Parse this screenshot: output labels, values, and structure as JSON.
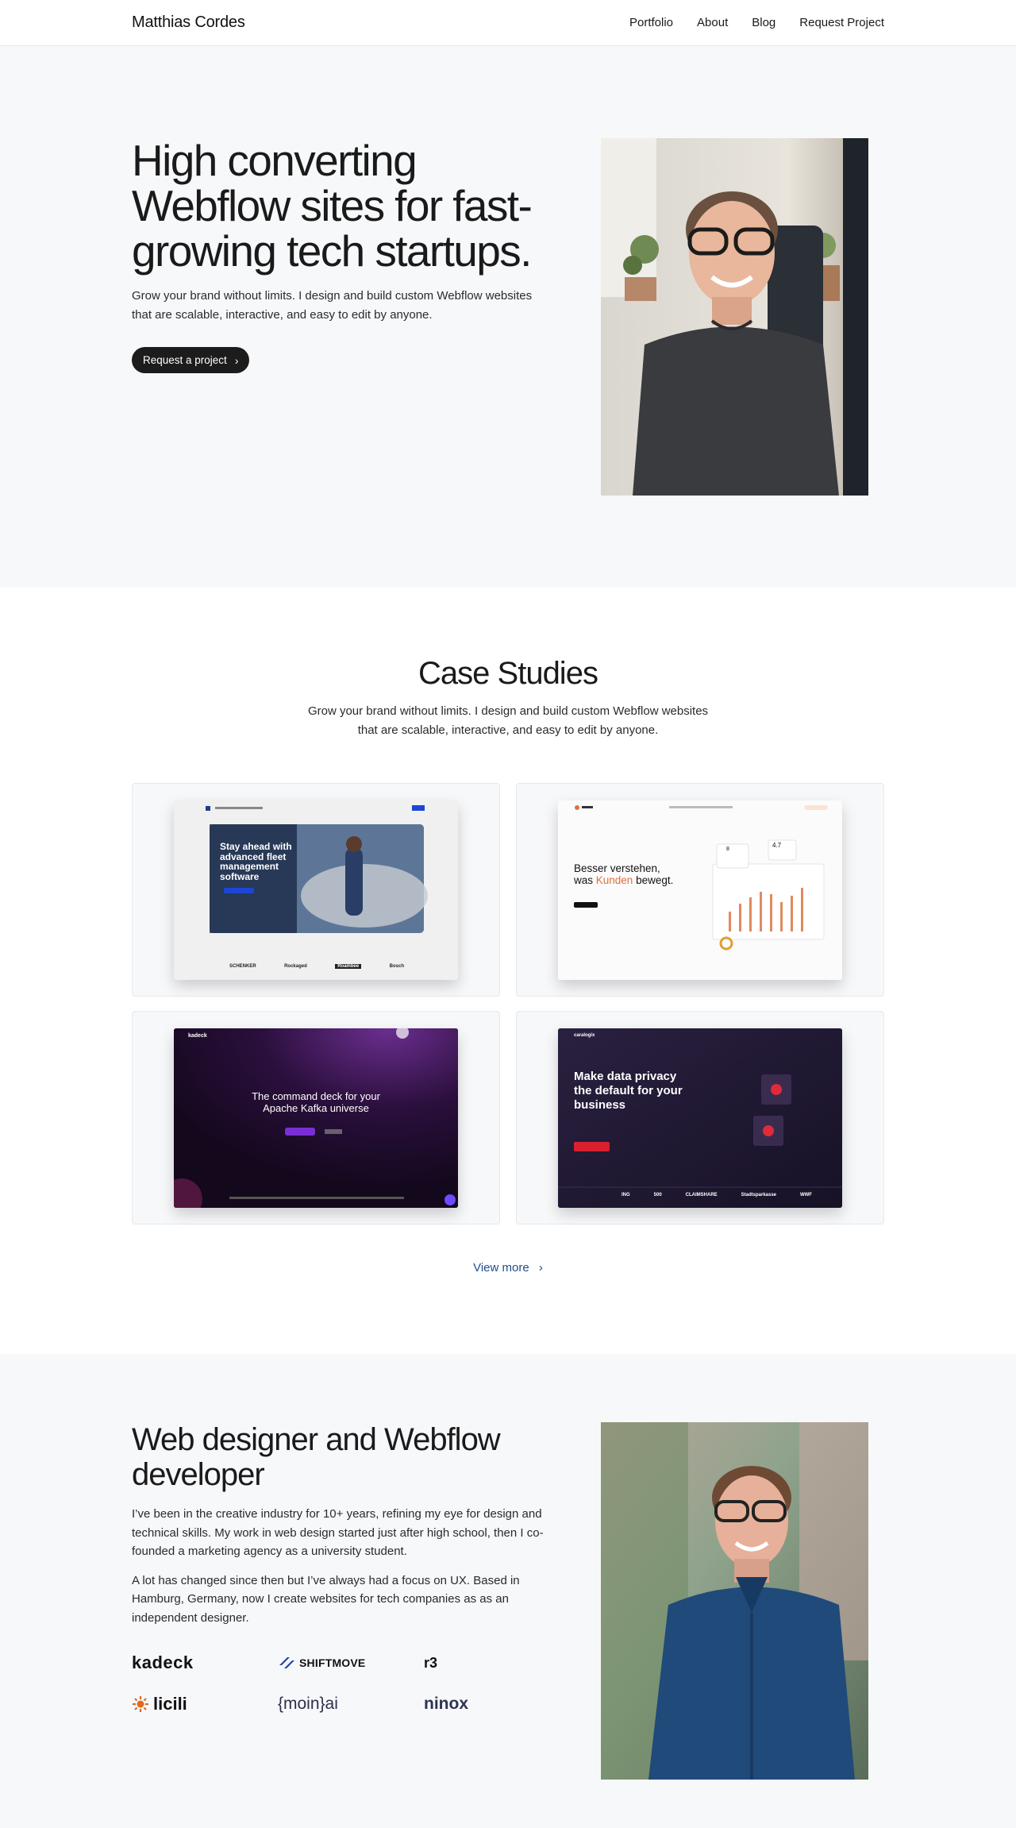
{
  "nav": {
    "brand": "Matthias Cordes",
    "links": [
      "Portfolio",
      "About",
      "Blog",
      "Request Project"
    ]
  },
  "hero": {
    "headline": "High converting Webflow sites for fast-growing tech startups.",
    "description": "Grow your brand without limits. I design and build custom Webflow websites that are scalable, interactive, and easy to edit by anyone.",
    "cta_label": "Request a project"
  },
  "case_studies": {
    "title": "Case Studies",
    "description": "Grow your brand without limits. I design and build custom Webflow websites that are scalable, interactive, and easy to edit by anyone.",
    "cards": [
      {
        "hero_text": "Stay ahead with advanced fleet management software",
        "logo_row": [
          "SCHENKER",
          "",
          "Rockaged",
          "Roambee",
          "Bosch"
        ]
      },
      {
        "hero_line_1": "Besser verstehen,",
        "hero_line_2_pre": "was ",
        "hero_line_2_accent": "Kunden",
        "hero_line_2_post": " bewegt.",
        "stat_value": "4.7",
        "stat_small": "8"
      },
      {
        "brand": "kadeck",
        "hero_text": "The command deck for your Apache Kafka universe"
      },
      {
        "brand": "caralogix",
        "hero_text": "Make data privacy the default for your business",
        "logo_row": [
          "ING",
          "500",
          "CLAIMSHARE",
          "Stadtsparkasse",
          "WWF"
        ]
      }
    ],
    "view_more": "View more",
    "colors": {
      "link": "#1f4b8f"
    }
  },
  "about": {
    "title": "Web designer and Webflow developer",
    "paragraph_1": "I’ve been in the creative industry for 10+ years, refining my eye for design and technical skills. My work in web design started just after high school, then I co-founded a marketing agency as a university student.",
    "paragraph_2": "A lot has changed since then but I’ve always had a focus on UX. Based in Hamburg, Germany, now I create websites for tech companies as as an independent designer.",
    "logos": [
      "kadeck",
      "SHIFTMOVE",
      "r3",
      "licili",
      "{moin}ai",
      "ninox"
    ]
  }
}
